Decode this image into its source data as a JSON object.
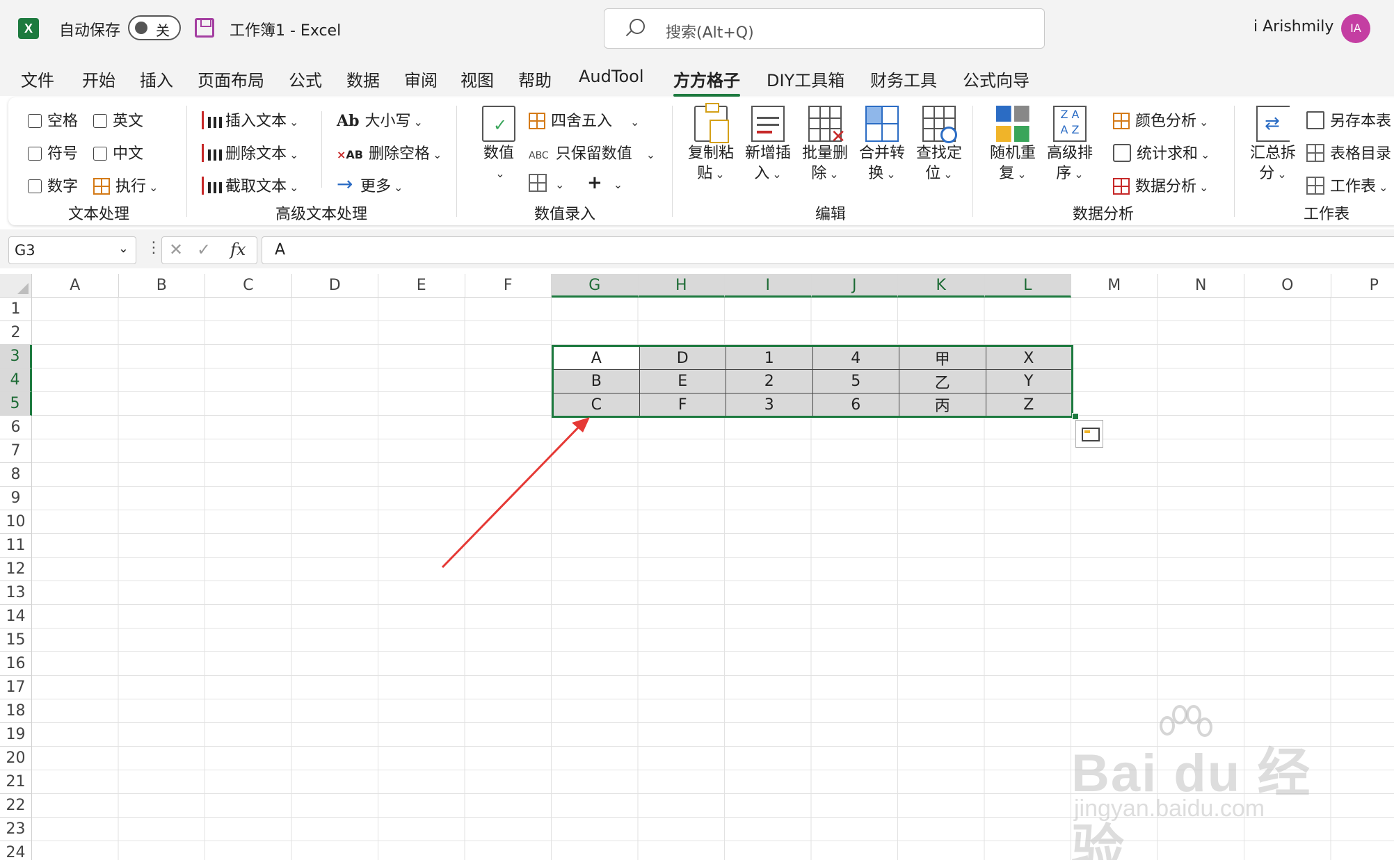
{
  "titlebar": {
    "app_logo": "X",
    "autosave_label": "自动保存",
    "autosave_state": "关",
    "doc_title": "工作簿1  -  Excel",
    "search_placeholder": "搜索(Alt+Q)",
    "user_name": "i Arishmily",
    "avatar_initials": "IA"
  },
  "tabs": [
    "文件",
    "开始",
    "插入",
    "页面布局",
    "公式",
    "数据",
    "审阅",
    "视图",
    "帮助",
    "AudTool",
    "方方格子",
    "DIY工具箱",
    "财务工具",
    "公式向导"
  ],
  "active_tab": "方方格子",
  "ribbon": {
    "text_group": {
      "checkboxes": [
        "空格",
        "英文",
        "符号",
        "中文",
        "数字"
      ],
      "execute": "执行",
      "label": "文本处理"
    },
    "adv_text_group": {
      "items": [
        "插入文本",
        "删除文本",
        "截取文本",
        "大小写",
        "删除空格",
        "更多"
      ],
      "ab_icon": "Ab",
      "ab_del_icon": "AB",
      "label": "高级文本处理"
    },
    "number_group": {
      "big": "数值",
      "items": [
        "四舍五入",
        "只保留数值"
      ],
      "abc_icon": "ABC",
      "plus": "+",
      "label": "数值录入"
    },
    "edit_group": {
      "buttons": [
        {
          "l1": "复制粘",
          "l2": "贴"
        },
        {
          "l1": "新增插",
          "l2": "入"
        },
        {
          "l1": "批量删",
          "l2": "除"
        },
        {
          "l1": "合并转",
          "l2": "换"
        },
        {
          "l1": "查找定",
          "l2": "位"
        }
      ],
      "label": "编辑"
    },
    "analysis_group": {
      "buttons": [
        {
          "l1": "随机重",
          "l2": "复"
        },
        {
          "l1": "高级排",
          "l2": "序"
        }
      ],
      "items": [
        "颜色分析",
        "统计求和",
        "数据分析"
      ],
      "label": "数据分析"
    },
    "sheet_group": {
      "big": {
        "l1": "汇总拆",
        "l2": "分"
      },
      "items": [
        "另存本表",
        "表格目录",
        "工作表"
      ],
      "label": "工作表"
    }
  },
  "formula_bar": {
    "name_box": "G3",
    "formula": "A",
    "fx": "fx"
  },
  "columns": [
    "A",
    "B",
    "C",
    "D",
    "E",
    "F",
    "G",
    "H",
    "I",
    "J",
    "K",
    "L",
    "M",
    "N",
    "O",
    "P"
  ],
  "selected_columns": [
    "G",
    "H",
    "I",
    "J",
    "K",
    "L"
  ],
  "rows": [
    "1",
    "2",
    "3",
    "4",
    "5",
    "6",
    "7",
    "8",
    "9",
    "10",
    "11",
    "12",
    "13",
    "14",
    "15",
    "16",
    "17",
    "18",
    "19",
    "20",
    "21",
    "22",
    "23",
    "24"
  ],
  "selected_rows": [
    "3",
    "4",
    "5"
  ],
  "cells": [
    [
      "A",
      "D",
      "1",
      "4",
      "甲",
      "X"
    ],
    [
      "B",
      "E",
      "2",
      "5",
      "乙",
      "Y"
    ],
    [
      "C",
      "F",
      "3",
      "6",
      "丙",
      "Z"
    ]
  ],
  "watermark": {
    "main": "Bai du 经验",
    "sub": "jingyan.baidu.com"
  },
  "colors": {
    "accent": "#1d7a3f",
    "selection_fill": "#d9d9d9",
    "annotation_arrow": "#e53935",
    "avatar": "#c43ea2"
  }
}
